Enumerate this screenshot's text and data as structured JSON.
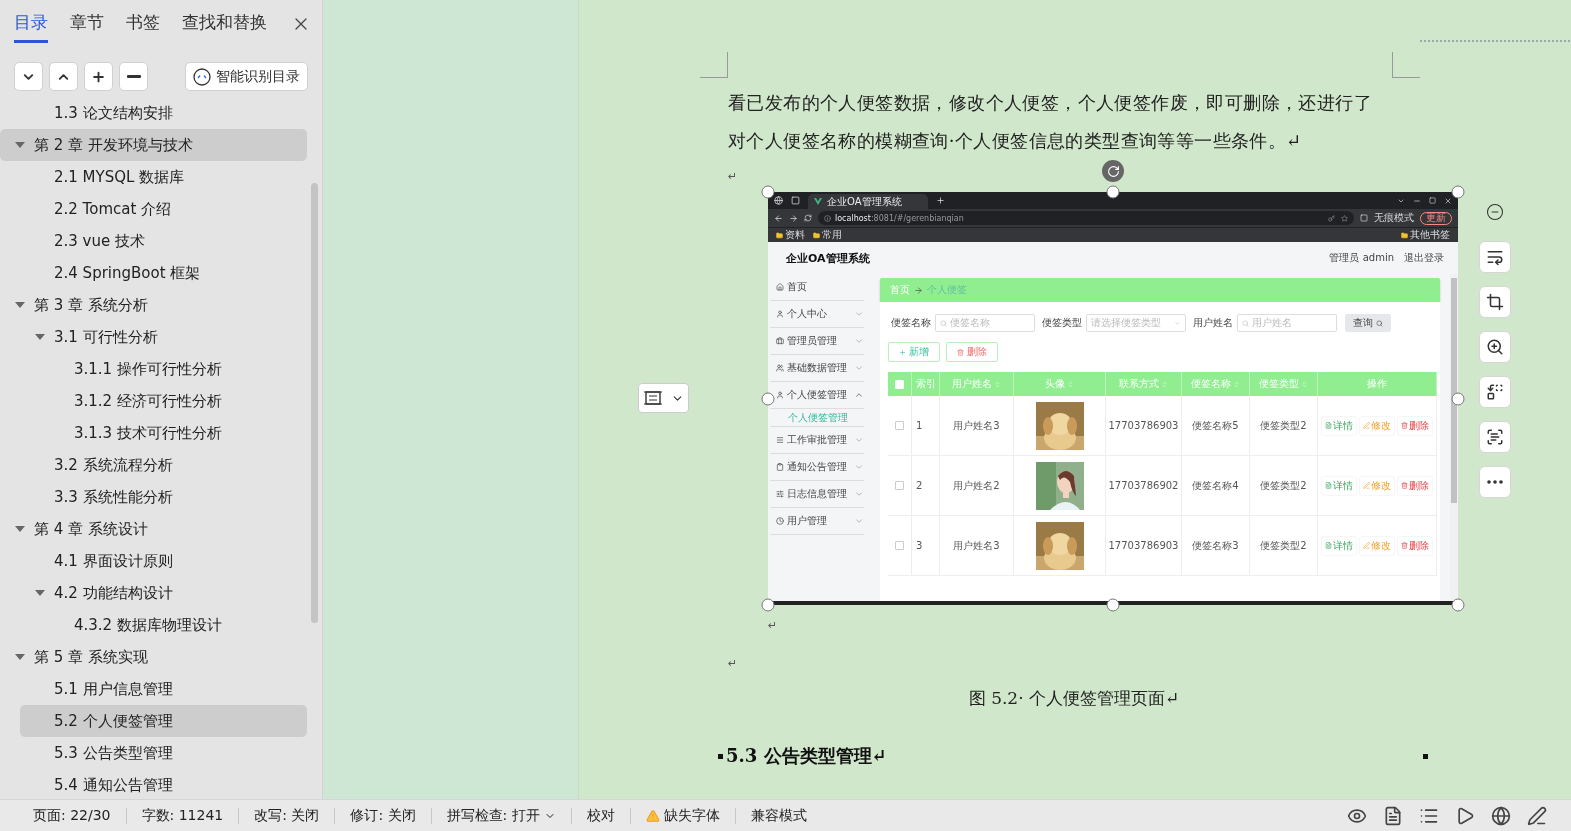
{
  "sidebar": {
    "tabs": [
      {
        "label": "目录",
        "selected": true
      },
      {
        "label": "章节",
        "selected": false
      },
      {
        "label": "书签",
        "selected": false
      },
      {
        "label": "查找和替换",
        "selected": false
      }
    ],
    "smart_button": "智能识别目录",
    "toc": [
      {
        "label": "1.3 论文结构安排",
        "kind": "continued",
        "selected": false
      },
      {
        "label": "第 2 章  开发环境与技术",
        "selected": true,
        "expanded": true,
        "children": [
          {
            "label": "2.1 MYSQL 数据库",
            "selected": false
          },
          {
            "label": "2.2 Tomcat  介绍",
            "selected": false
          },
          {
            "label": "2.3 vue 技术",
            "selected": false
          },
          {
            "label": "2.4 SpringBoot 框架",
            "selected": false
          }
        ]
      },
      {
        "label": "第 3 章  系统分析",
        "selected": false,
        "expanded": true,
        "children": [
          {
            "label": "3.1 可行性分析",
            "selected": false,
            "expanded": true,
            "children": [
              {
                "label": "3.1.1 操作可行性分析",
                "selected": false
              },
              {
                "label": "3.1.2 经济可行性分析",
                "selected": false
              },
              {
                "label": "3.1.3 技术可行性分析",
                "selected": false
              }
            ]
          },
          {
            "label": "3.2 系统流程分析",
            "selected": false
          },
          {
            "label": "3.3 系统性能分析",
            "selected": false
          }
        ]
      },
      {
        "label": "第 4 章  系统设计",
        "selected": false,
        "expanded": true,
        "children": [
          {
            "label": "4.1 界面设计原则",
            "selected": false
          },
          {
            "label": "4.2 功能结构设计",
            "selected": false,
            "expanded": true,
            "children": [
              {
                "label": "4.3.2  数据库物理设计",
                "selected": false
              }
            ]
          }
        ]
      },
      {
        "label": "第 5 章  系统实现",
        "selected": false,
        "expanded": true,
        "children": [
          {
            "label": "5.1 用户信息管理",
            "selected": false
          },
          {
            "label": "5.2  个人便签管理",
            "selected": true
          },
          {
            "label": "5.3 公告类型管理",
            "selected": false
          },
          {
            "label": "5.4 通知公告管理",
            "selected": false
          }
        ]
      }
    ]
  },
  "document": {
    "paragraph_lines": [
      "看已发布的个人便签数据，修改个人便签，个人便签作废，即可删除，还进行了",
      "对个人便签名称的模糊查询·个人便签信息的类型查询等等一些条件。↵"
    ],
    "return_mark": "↵",
    "figure_return_mark": "↵",
    "after_figure_mark": "↵",
    "caption": "图 5.2· 个人便签管理页面↵",
    "heading": "5.3 公告类型管理↵",
    "screenshot": {
      "browser": {
        "tab_title": "企业OA管理系统",
        "url_host": "localhost",
        "url_rest": ":8081/#/gerenbianqian",
        "bookmarks": [
          "资料",
          "常用"
        ],
        "other_bookmarks": "其他书签",
        "profile": "无痕模式",
        "update": "更新"
      },
      "app": {
        "title": "企业OA管理系统",
        "user": "管理员 admin",
        "logout": "退出登录",
        "menu": [
          {
            "label": "首页"
          },
          {
            "label": "个人中心",
            "expanded": false
          },
          {
            "label": "管理员管理",
            "expanded": false
          },
          {
            "label": "基础数据管理",
            "expanded": false
          },
          {
            "label": "个人便签管理",
            "expanded": true,
            "children": [
              {
                "label": "个人便签管理",
                "selected": true
              }
            ]
          },
          {
            "label": "工作审批管理",
            "expanded": false
          },
          {
            "label": "通知公告管理",
            "expanded": false
          },
          {
            "label": "日志信息管理",
            "expanded": false
          },
          {
            "label": "用户管理",
            "expanded": false
          }
        ],
        "all_checked": false,
        "breadcrumb": [
          "首页",
          "个人便签"
        ],
        "filters": [
          {
            "label": "便签名称",
            "placeholder": "便签名称",
            "kind": "search"
          },
          {
            "label": "便签类型",
            "placeholder": "请选择便签类型",
            "kind": "select"
          },
          {
            "label": "用户姓名",
            "placeholder": "用户姓名",
            "kind": "search"
          }
        ],
        "query_button": "查询",
        "actions": [
          {
            "label": "新增",
            "kind": "add"
          },
          {
            "label": "删除",
            "kind": "delete"
          }
        ],
        "columns": [
          {
            "label": "索引",
            "sortable": false
          },
          {
            "label": "用户姓名",
            "sortable": true
          },
          {
            "label": "头像",
            "sortable": true
          },
          {
            "label": "联系方式",
            "sortable": true
          },
          {
            "label": "便签名称",
            "sortable": true
          },
          {
            "label": "便签类型",
            "sortable": true
          },
          {
            "label": "操作",
            "sortable": false
          }
        ],
        "rows": [
          {
            "checked": false,
            "index": "1",
            "user": "用户姓名3",
            "phone": "17703786903",
            "name": "便签名称5",
            "type": "便签类型2",
            "actions": [
              "详情",
              "修改",
              "删除"
            ]
          },
          {
            "checked": false,
            "index": "2",
            "user": "用户姓名2",
            "phone": "17703786902",
            "name": "便签名称4",
            "type": "便签类型2",
            "actions": [
              "详情",
              "修改",
              "删除"
            ]
          },
          {
            "checked": false,
            "index": "3",
            "user": "用户姓名3",
            "phone": "17703786903",
            "name": "便签名称3",
            "type": "便签类型2",
            "actions": [
              "详情",
              "修改",
              "删除"
            ]
          }
        ]
      }
    }
  },
  "status_bar": {
    "items": [
      {
        "label": "页面: 22/30",
        "kind": "text"
      },
      {
        "label": "字数: 11241",
        "kind": "text"
      },
      {
        "label": "改写: 关闭",
        "kind": "text"
      },
      {
        "label": "修订: 关闭",
        "kind": "text"
      },
      {
        "label": "拼写检查: 打开",
        "kind": "dropdown"
      },
      {
        "label": "校对",
        "kind": "text"
      },
      {
        "label": "缺失字体",
        "kind": "warning"
      },
      {
        "label": "兼容模式",
        "kind": "text"
      }
    ]
  }
}
